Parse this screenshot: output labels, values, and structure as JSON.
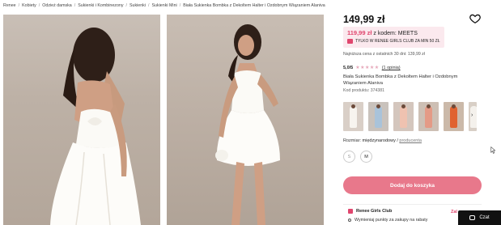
{
  "breadcrumb": [
    "Renee",
    "Kobiety",
    "Odzież damska",
    "Sukienki i Kombinezony",
    "Sukienki",
    "Sukienki Mini",
    "Biała Sukienka Bombka z Dekoltem Halter i Ozdobnym Wiązaniem Alaniva"
  ],
  "product": {
    "price": "149,99 zł",
    "promo_price": "119,99 zł",
    "promo_code_text": "z kodem: MEETS",
    "promo_club_text": "TYLKO W RENEE GIRLS CLUB ZA MIN 50 ZŁ",
    "lowest_price": "Najniższa cena z ostatnich 30 dni: 139,99 zł",
    "rating": "5,0/5",
    "stars": [
      "★",
      "★",
      "★",
      "★",
      "★"
    ],
    "opinions": "(1 opinia)",
    "title": "Biała Sukienka Bombka z Dekoltem Halter i Ozdobnym Wiązaniem Alaniva",
    "code": "Kod produktu: 374381"
  },
  "thumbnails": [
    {
      "bg": "#d9cfc7",
      "dress": "#f7f4ef"
    },
    {
      "bg": "#c9c2bc",
      "dress": "#a9c3da"
    },
    {
      "bg": "#d4c6bd",
      "dress": "#efc2b0"
    },
    {
      "bg": "#cdbfb4",
      "dress": "#e49a86"
    },
    {
      "bg": "#cbb9a9",
      "dress": "#e0622f"
    },
    {
      "bg": "#d8cfc6",
      "dress": "#f4f1ec"
    }
  ],
  "size": {
    "label": "Rozmiar:",
    "value": "międzynarodowy",
    "separator": "/",
    "link": "producenta",
    "options": [
      "S",
      "M"
    ]
  },
  "add_to_cart": "Dodaj do koszyka",
  "club": {
    "title": "Renee Girls Club",
    "action": "Zal",
    "item": "Wymieniaj punkty za zakupy na rabaty"
  },
  "chat": "Czat",
  "colors": {
    "accent": "#e8788b",
    "promo_bg": "#fbe9ee",
    "promo_text": "#e0466e"
  }
}
